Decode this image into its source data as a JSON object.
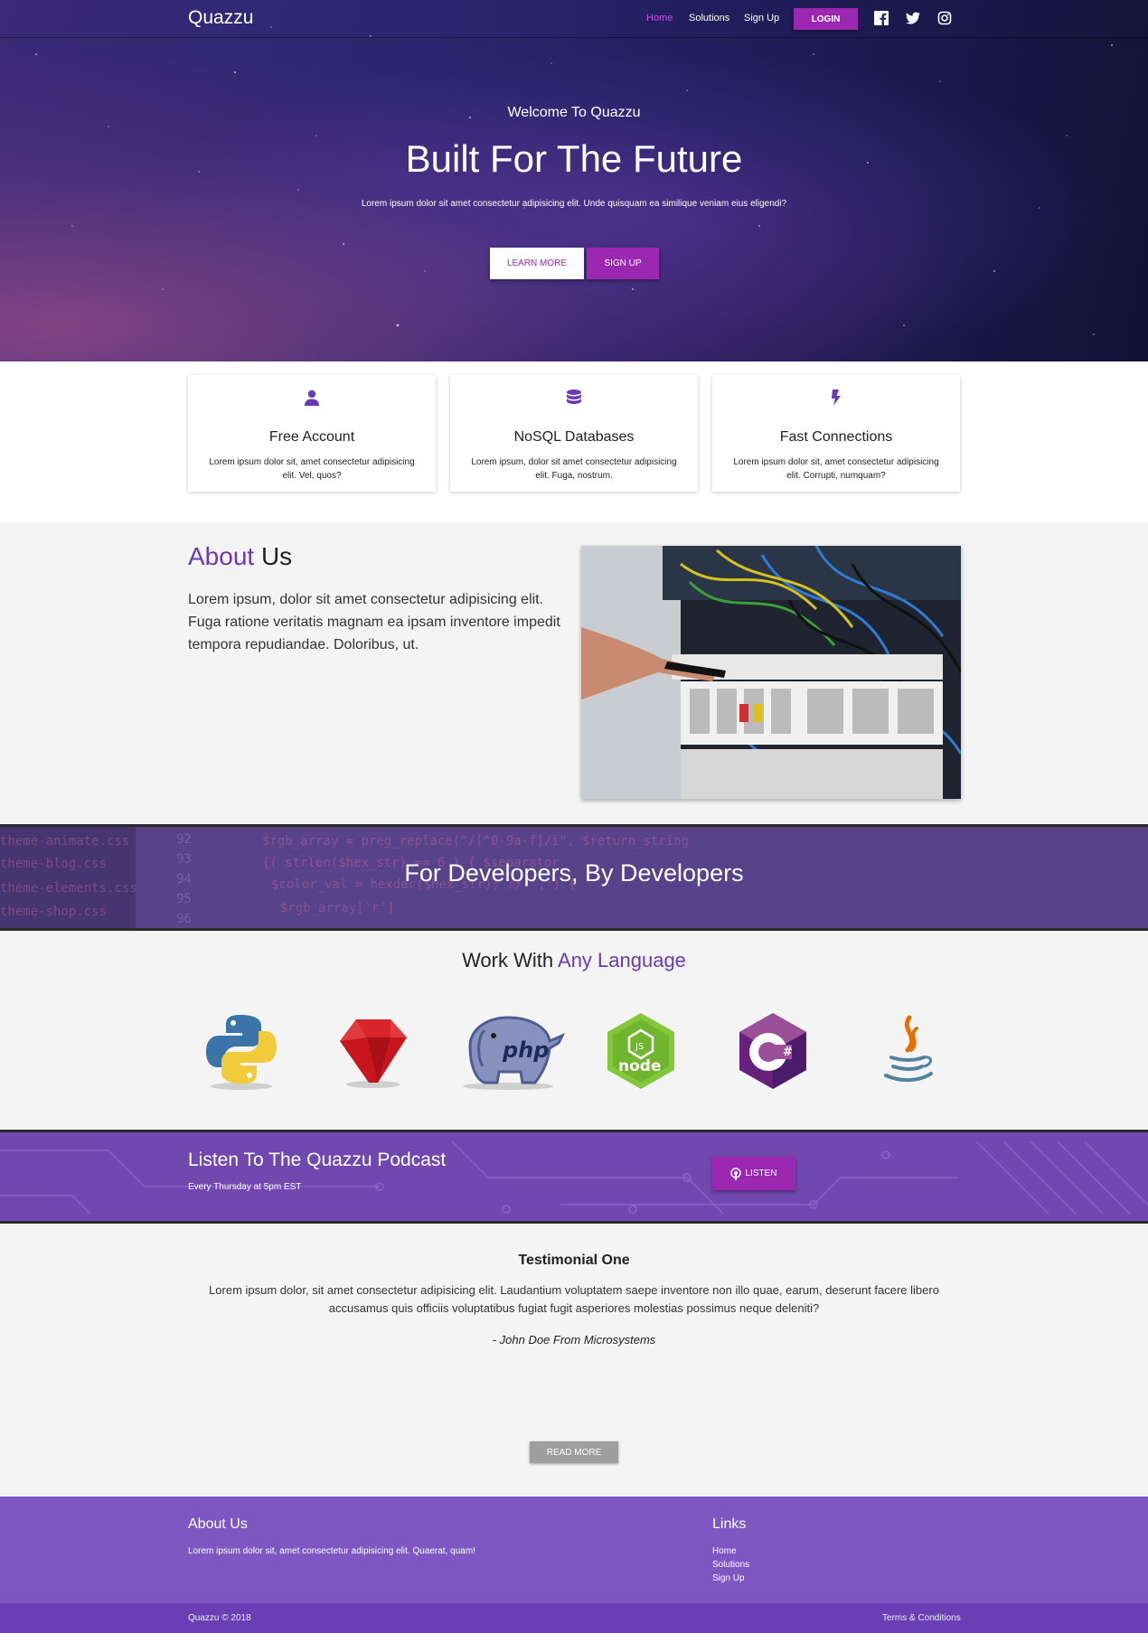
{
  "nav": {
    "brand": "Quazzu",
    "links": [
      "Home",
      "Solutions",
      "Sign Up"
    ],
    "login": "LOGIN",
    "social": [
      "facebook-icon",
      "twitter-icon",
      "instagram-icon"
    ]
  },
  "hero": {
    "subtitle": "Welcome To Quazzu",
    "title": "Built For The Future",
    "text": "Lorem ipsum dolor sit amet consectetur adipisicing elit. Unde quisquam ea similique veniam eius eligendi?",
    "learn_more": "LEARN MORE",
    "sign_up": "SIGN UP"
  },
  "features": [
    {
      "icon": "user-icon",
      "title": "Free Account",
      "text": "Lorem ipsum dolor sit, amet consectetur adipisicing elit. Vel, quos?"
    },
    {
      "icon": "database-icon",
      "title": "NoSQL Databases",
      "text": "Lorem ipsum, dolor sit amet consectetur adipisicing elit. Fuga, nostrum."
    },
    {
      "icon": "bolt-icon",
      "title": "Fast Connections",
      "text": "Lorem ipsum dolor sit, amet consectetur adipisicing elit. Corrupti, numquam?"
    }
  ],
  "about": {
    "title_accent": "About",
    "title_rest": " Us",
    "text": "Lorem ipsum, dolor sit amet consectetur adipisicing elit. Fuga ratione veritatis magnam ea ipsam inventore impedit tempora repudiandae. Doloribus, ut."
  },
  "devs": {
    "title": "For Developers, By Developers"
  },
  "langs": {
    "title_plain": "Work With ",
    "title_accent": "Any Language",
    "logos": [
      "python-logo",
      "ruby-logo",
      "php-logo",
      "nodejs-logo",
      "csharp-logo",
      "java-logo"
    ]
  },
  "podcast": {
    "title": "Listen To The Quazzu Podcast",
    "schedule": "Every Thursday at 5pm EST",
    "listen": "LISTEN"
  },
  "testimonial": {
    "title": "Testimonial One",
    "quote": "Lorem ipsum dolor, sit amet consectetur adipisicing elit. Laudantium voluptatem saepe inventore non illo quae, earum, deserunt facere libero accusamus quis officiis voluptatibus fugiat fugit asperiores molestias possimus neque deleniti?",
    "author": "- John Doe From Microsystems",
    "read_more": "READ MORE"
  },
  "footer": {
    "about_title": "About Us",
    "about_text": "Lorem ipsum dolor sit, amet consectetur adipisicing elit. Quaerat, quam!",
    "links_title": "Links",
    "links": [
      "Home",
      "Solutions",
      "Sign Up"
    ],
    "copyright": "Quazzu © 2018",
    "terms": "Terms & Conditions"
  },
  "colors": {
    "primary": "#9c27b0",
    "accent": "#673ab7",
    "nav_active": "#e040fb",
    "footer": "#7e57c2",
    "footer_bottom": "#6a3fb5"
  }
}
